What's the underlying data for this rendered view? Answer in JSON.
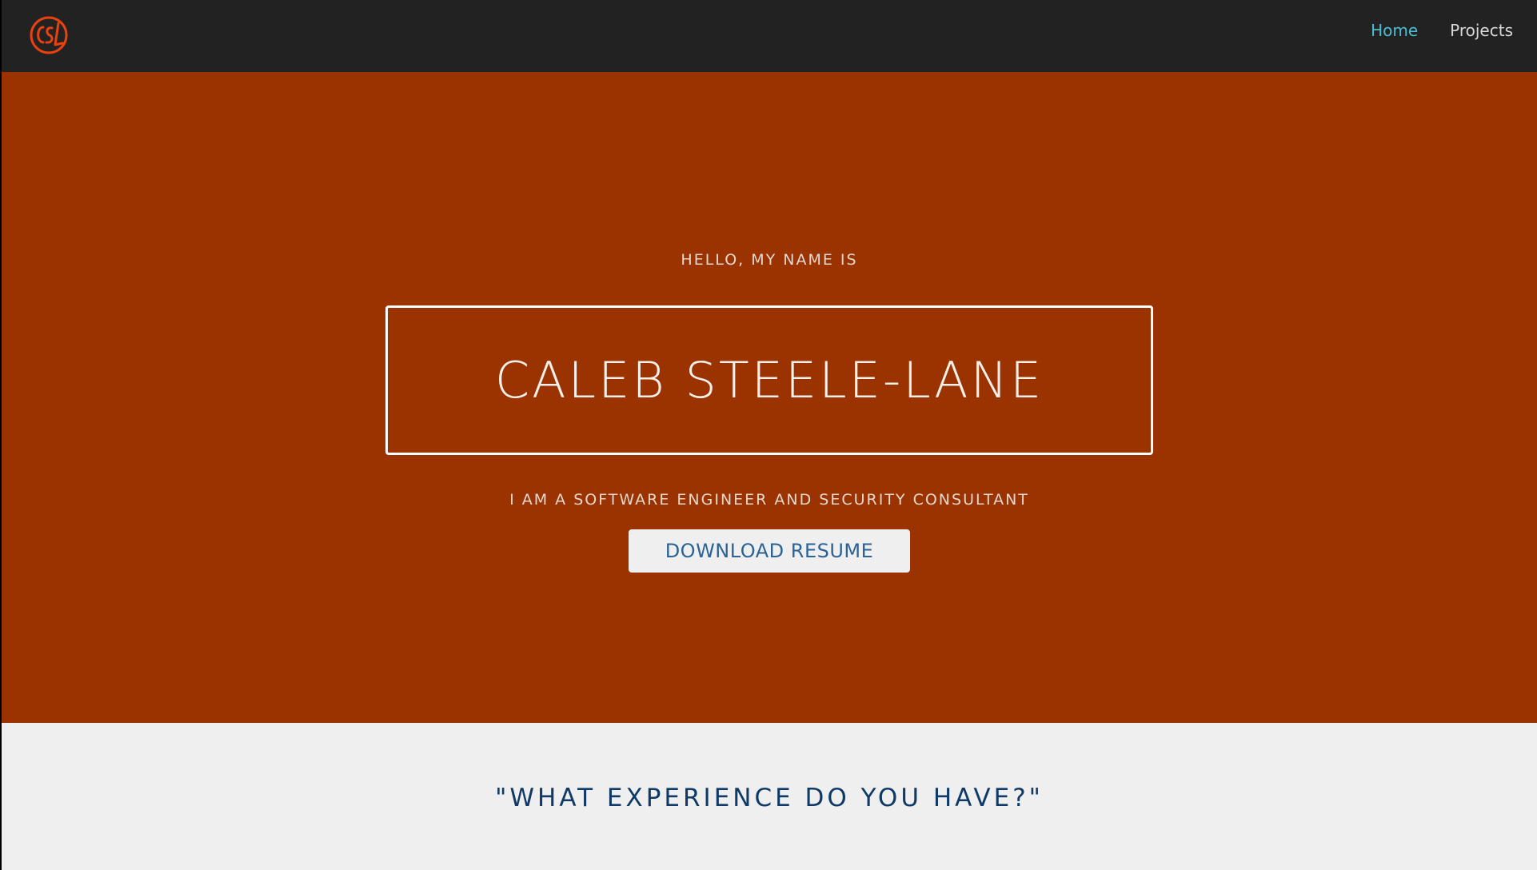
{
  "nav": {
    "logo_icon": "csl-monogram-icon",
    "logo_color": "#e8420f",
    "links": [
      {
        "label": "Home",
        "active": true
      },
      {
        "label": "Projects",
        "active": false
      }
    ]
  },
  "hero": {
    "greeting": "HELLO, MY NAME IS",
    "name": "CALEB STEELE-LANE",
    "tagline": "I AM A SOFTWARE ENGINEER AND SECURITY CONSULTANT",
    "resume_button": "DOWNLOAD RESUME",
    "background_color": "#9a3300"
  },
  "experience": {
    "heading": "\"WHAT EXPERIENCE DO YOU HAVE?\""
  },
  "colors": {
    "nav_bg": "#222222",
    "nav_active": "#4bbdd2",
    "heading_blue": "#0f3a66",
    "button_text": "#2b6396"
  }
}
